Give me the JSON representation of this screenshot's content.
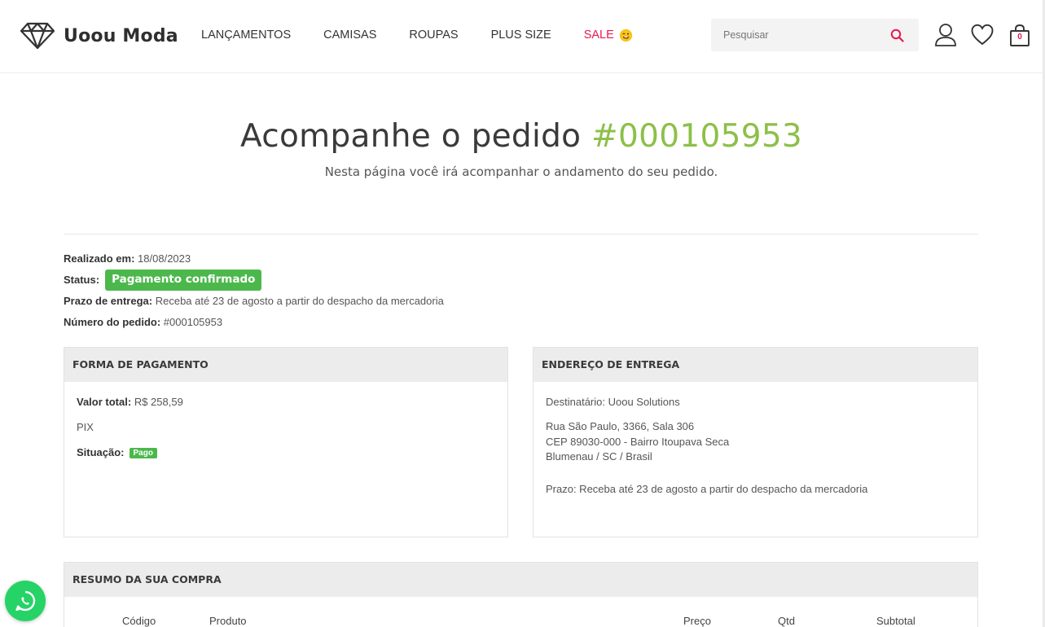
{
  "brand": {
    "name": "Uoou Moda"
  },
  "nav": [
    {
      "label": "LANÇAMENTOS"
    },
    {
      "label": "CAMISAS"
    },
    {
      "label": "ROUPAS"
    },
    {
      "label": "PLUS SIZE"
    },
    {
      "label": "SALE",
      "icon": "winking-face-emoji"
    }
  ],
  "search": {
    "placeholder": "Pesquisar",
    "value": ""
  },
  "cart": {
    "count": "0"
  },
  "icons": [
    "diamond-logo-icon",
    "search-icon",
    "user-icon",
    "heart-icon",
    "shopping-bag-icon",
    "whatsapp-icon"
  ],
  "colors": {
    "accent": "#8cc049",
    "sale": "#e8174d",
    "status_green": "#4cb84c",
    "panel_header": "#ececec"
  },
  "page": {
    "title_prefix": "Acompanhe o pedido",
    "order_number": "#000105953",
    "subtitle": "Nesta página você irá acompanhar o andamento do seu pedido."
  },
  "order": {
    "placed_label": "Realizado em:",
    "placed_value": "18/08/2023",
    "status_label": "Status:",
    "status_value": "Pagamento confirmado",
    "delivery_label": "Prazo de entrega:",
    "delivery_value": "Receba até 23 de agosto a partir do despacho da mercadoria",
    "number_label": "Número do pedido:",
    "number_value": "#000105953"
  },
  "payment": {
    "heading": "FORMA DE PAGAMENTO",
    "total_label": "Valor total:",
    "total_value": "R$ 258,59",
    "method": "PIX",
    "situation_label": "Situação:",
    "situation_value": "Pago"
  },
  "address": {
    "heading": "ENDEREÇO DE ENTREGA",
    "recipient": "Destinatário: Uoou Solutions",
    "line1": "Rua São Paulo, 3366, Sala 306",
    "line2": "CEP 89030-000 - Bairro Itoupava Seca",
    "line3": "Blumenau / SC / Brasil",
    "deadline": "Prazo: Receba até 23 de agosto a partir do despacho da mercadoria"
  },
  "summary": {
    "heading": "RESUMO DA SUA COMPRA",
    "columns": [
      "Código",
      "Produto",
      "Preço",
      "Qtd",
      "Subtotal"
    ]
  }
}
